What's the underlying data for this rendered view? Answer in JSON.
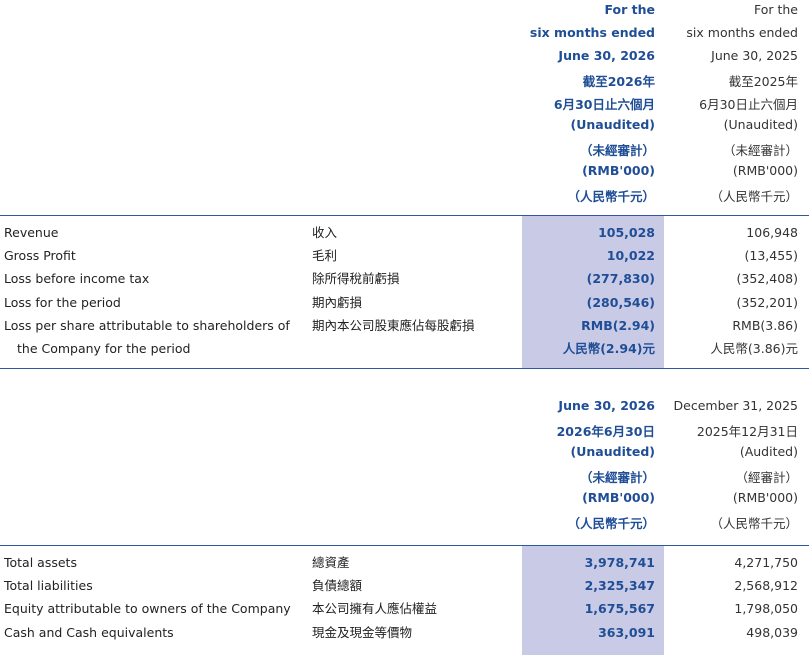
{
  "period_header": {
    "current": [
      "For the",
      "six months ended",
      "June 30, 2026",
      "截至2026年",
      "6月30日止六個月",
      "(Unaudited)",
      "（未經審計）",
      "(RMB'000)",
      "（人民幣千元）"
    ],
    "prior": [
      "For the",
      "six months ended",
      "June 30, 2025",
      "截至2025年",
      "6月30日止六個月",
      "(Unaudited)",
      "（未經審計）",
      "(RMB'000)",
      "（人民幣千元）"
    ]
  },
  "income_rows": [
    {
      "en": "Revenue",
      "zh": "收入",
      "current": "105,028",
      "prior": "106,948"
    },
    {
      "en": "Gross Profit",
      "zh": "毛利",
      "current": "10,022",
      "prior": "(13,455)"
    },
    {
      "en": "Loss before income tax",
      "zh": "除所得稅前虧損",
      "current": "(277,830)",
      "prior": "(352,408)"
    },
    {
      "en": "Loss for the period",
      "zh": "期內虧損",
      "current": "(280,546)",
      "prior": "(352,201)"
    },
    {
      "en": "Loss per share attributable to shareholders of",
      "zh": "期內本公司股東應佔每股虧損",
      "current": "RMB(2.94)",
      "prior": "RMB(3.86)"
    },
    {
      "en": "the Company for the period",
      "zh": "",
      "current": "人民幣(2.94)元",
      "prior": "人民幣(3.86)元"
    }
  ],
  "balance_header": {
    "current": [
      "June 30, 2026",
      "2026年6月30日",
      "(Unaudited)",
      "（未經審計）",
      "(RMB'000)",
      "（人民幣千元）"
    ],
    "prior": [
      "December 31, 2025",
      "2025年12月31日",
      "(Audited)",
      "（經審計）",
      "(RMB'000)",
      "（人民幣千元）"
    ]
  },
  "balance_rows": [
    {
      "en": "Total assets",
      "zh": "總資產",
      "current": "3,978,741",
      "prior": "4,271,750"
    },
    {
      "en": "Total liabilities",
      "zh": "負債總額",
      "current": "2,325,347",
      "prior": "2,568,912"
    },
    {
      "en": "Equity attributable to owners of the Company",
      "zh": "本公司擁有人應佔權益",
      "current": "1,675,567",
      "prior": "1,798,050"
    },
    {
      "en": "Cash and Cash equivalents",
      "zh": "現金及現金等價物",
      "current": "363,091",
      "prior": "498,039"
    }
  ]
}
